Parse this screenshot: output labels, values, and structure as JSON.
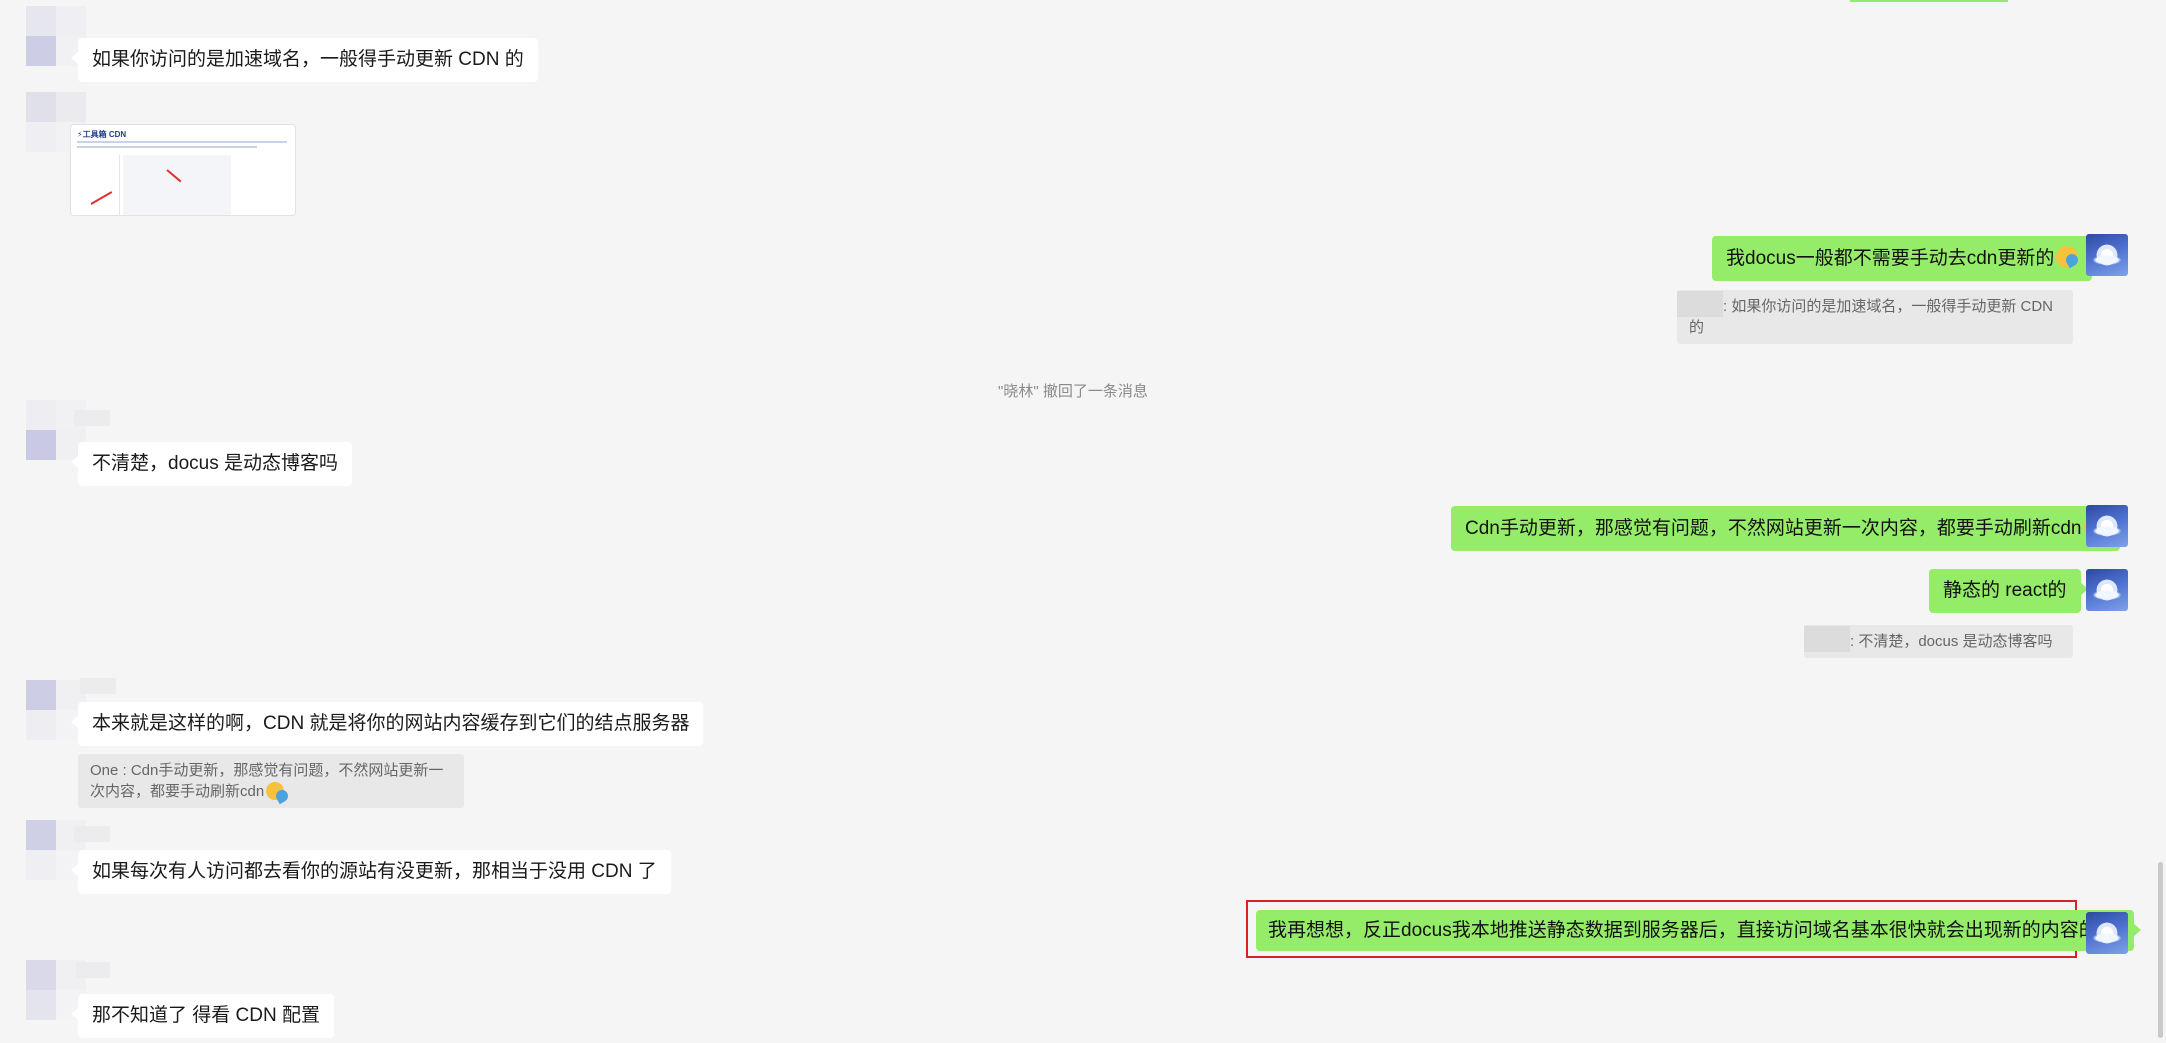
{
  "messages": {
    "m1": "如果你访问的是加速域名，一般得手动更新 CDN 的",
    "m2_image_title": "⚡工具箱 CDN",
    "m3": "我docus一般都不需要手动去cdn更新的",
    "m3_quote": ": 如果你访问的是加速域名，一般得手动更新 CDN 的",
    "sys_recall": "\"晓林\" 撤回了一条消息",
    "m4": "不清楚，docus 是动态博客吗",
    "m5": "Cdn手动更新，那感觉有问题，不然网站更新一次内容，都要手动刷新cdn",
    "m6": "静态的 react的",
    "m6_quote": ": 不清楚，docus 是动态博客吗",
    "m7": "本来就是这样的啊，CDN 就是将你的网站内容缓存到它们的结点服务器",
    "m7_quote": "One : Cdn手动更新，那感觉有问题，不然网站更新一次内容，都要手动刷新cdn",
    "m8": "如果每次有人访问都去看你的源站有没更新，那相当于没用 CDN 了",
    "m9": "我再想想，反正docus我本地推送静态数据到服务器后，直接访问域名基本很快就会出现新的内容的",
    "m10": "那不知道了 得看 CDN 配置"
  },
  "icons": {
    "emoji": "laugh-cry-emoji-icon",
    "avatar_me": "flower-avatar-icon"
  },
  "colors": {
    "bubble_me": "#95ec69",
    "bubble_other": "#ffffff",
    "background": "#f5f5f5",
    "highlight": "#e02020"
  }
}
